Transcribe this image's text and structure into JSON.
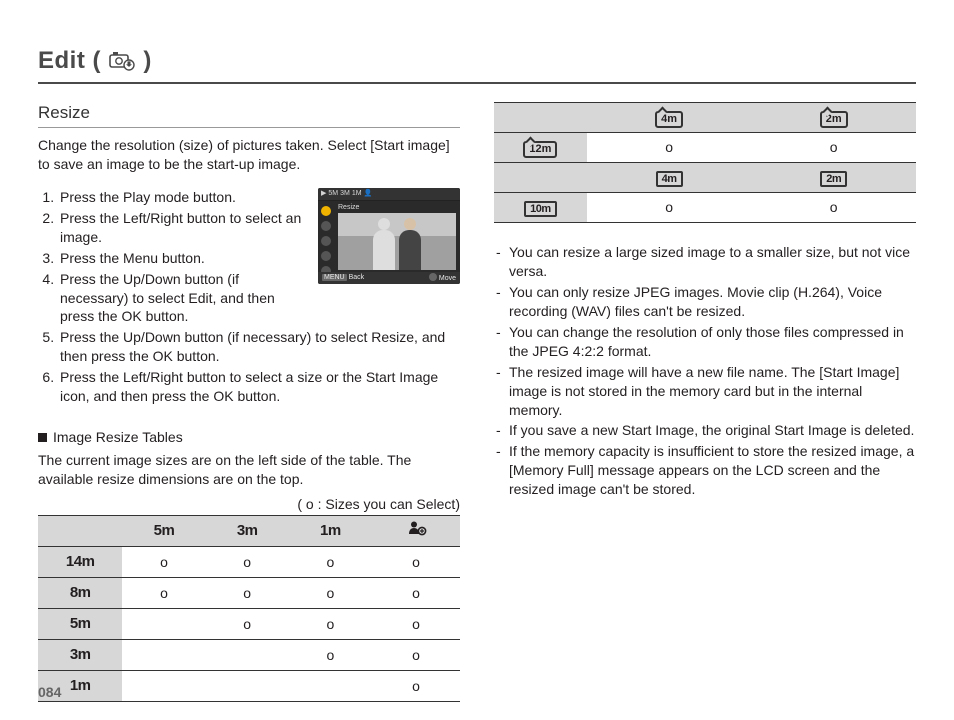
{
  "page_title_prefix": "Edit (",
  "page_title_suffix": ")",
  "section_heading": "Resize",
  "intro": "Change the resolution (size) of pictures taken. Select [Start image] to save an image to be the start-up image.",
  "steps": [
    "Press the Play mode button.",
    "Press the Left/Right button to select an image.",
    "Press the Menu button.",
    "Press the Up/Down button (if necessary) to select Edit, and then press the OK button.",
    "Press the Up/Down button (if necessary) to select Resize, and then press the OK button.",
    "Press the Left/Right button to select a size or the Start Image icon, and then press the OK button."
  ],
  "camera_screen": {
    "mode_label": "Resize",
    "back": "Back",
    "move": "Move"
  },
  "subhead": "Image Resize Tables",
  "subhead_desc": "The current image sizes are on the left side of the table. The available resize dimensions are on the top.",
  "table_note": "( o : Sizes you can Select)",
  "table1": {
    "cols": [
      "5m",
      "3m",
      "1m",
      "start"
    ],
    "rows": [
      {
        "label": "14m",
        "cells": [
          "o",
          "o",
          "o",
          "o"
        ]
      },
      {
        "label": "8m",
        "cells": [
          "o",
          "o",
          "o",
          "o"
        ]
      },
      {
        "label": "5m",
        "cells": [
          "",
          "o",
          "o",
          "o"
        ]
      },
      {
        "label": "3m",
        "cells": [
          "",
          "",
          "o",
          "o"
        ]
      },
      {
        "label": "1m",
        "cells": [
          "",
          "",
          "",
          "o"
        ]
      }
    ]
  },
  "table2a": {
    "cols": [
      "4m",
      "2m"
    ],
    "row_label": "12m",
    "cells": [
      "o",
      "o"
    ]
  },
  "table2b": {
    "cols": [
      "4m",
      "2m"
    ],
    "row_label": "10m",
    "cells": [
      "o",
      "o"
    ]
  },
  "notes": [
    "You can resize a large sized image to a smaller size, but not vice versa.",
    "You can only resize JPEG images. Movie clip (H.264), Voice recording (WAV) files can't be resized.",
    "You can change the resolution of only those files compressed in the JPEG 4:2:2 format.",
    "The resized image will have a new file name. The [Start Image] image is not stored in the memory card but in the internal memory.",
    "If you save a new Start Image, the original Start Image is deleted.",
    "If the memory capacity is insufficient to store the resized image, a [Memory Full] message appears on the LCD screen and the resized image can't be stored."
  ],
  "page_number": "084"
}
